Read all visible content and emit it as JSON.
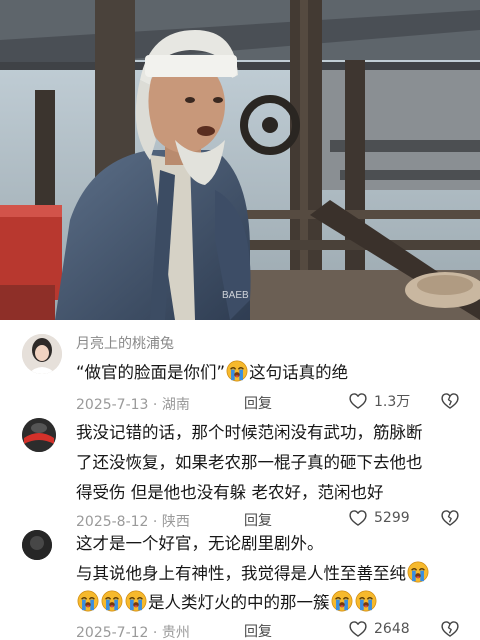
{
  "video": {
    "watermark": "BAEB"
  },
  "comments": [
    {
      "username": "月亮上的桃浦兔",
      "text_parts": [
        "“做官的脸面是你们”",
        "这句话真的绝"
      ],
      "date": "2025-7-13",
      "location": "湖南",
      "reply_label": "回复",
      "likes": "1.3万"
    },
    {
      "lines": [
        "我没记错的话，那个时候范闲没有武功，筋脉断",
        "了还没恢复，如果老农那一棍子真的砸下去他也",
        "得受伤  但是他也没有躲  老农好，范闲也好"
      ],
      "date": "2025-8-12",
      "location": "陕西",
      "reply_label": "回复",
      "likes": "5299"
    },
    {
      "line1": "这才是一个好官，无论剧里剧外。",
      "line2": "与其说他身上有神性，我觉得是人性至善至纯",
      "line3_text": "是人类灯火的中的那一簇",
      "date": "2025-7-12",
      "location": "贵州",
      "reply_label": "回复",
      "likes": "2648"
    }
  ],
  "icons": {
    "emoji": "loudly-crying-emoji",
    "like": "heart-outline-icon",
    "dislike": "broken-heart-icon"
  },
  "colors": {
    "meta": "#9a9a9a",
    "text": "#161616",
    "username": "#8a8a8a",
    "emoji": "#f5b62a",
    "tear": "#3a8ee0"
  }
}
